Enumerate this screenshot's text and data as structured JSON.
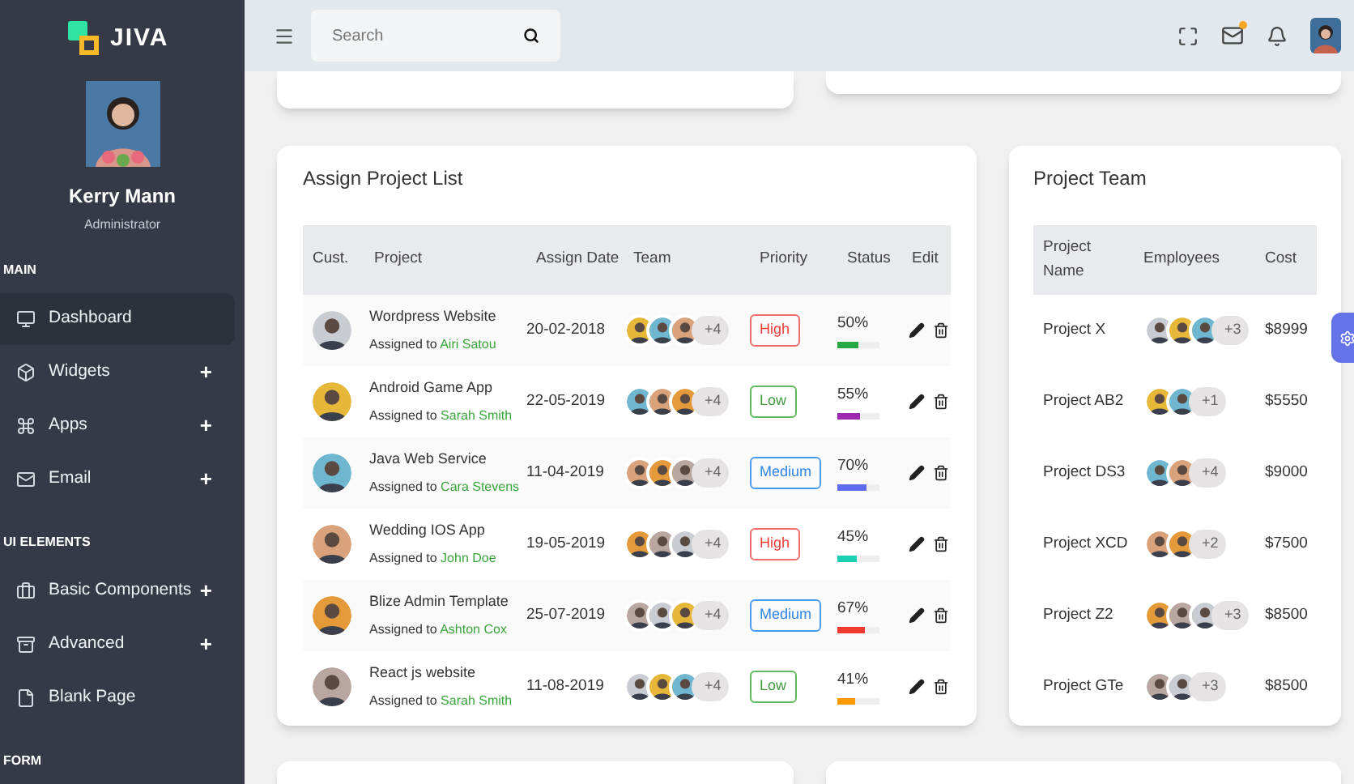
{
  "brand": {
    "name": "JIVA"
  },
  "profile": {
    "name": "Kerry Mann",
    "role": "Administrator"
  },
  "sidebar": {
    "sections": [
      {
        "title": "MAIN",
        "items": [
          {
            "label": "Dashboard",
            "selected": true
          },
          {
            "label": "Widgets",
            "selected": false,
            "toggle": "+"
          },
          {
            "label": "Apps",
            "selected": false,
            "toggle": "+"
          },
          {
            "label": "Email",
            "selected": false,
            "toggle": "+"
          }
        ]
      },
      {
        "title": "UI ELEMENTS",
        "items": [
          {
            "label": "Basic Components",
            "selected": false,
            "toggle": "+"
          },
          {
            "label": "Advanced",
            "selected": false,
            "toggle": "+"
          },
          {
            "label": "Blank Page",
            "selected": false
          }
        ]
      },
      {
        "title": "FORM"
      }
    ]
  },
  "header": {
    "search": {
      "placeholder": "Search"
    },
    "mail_unread": true
  },
  "assign_project_list": {
    "title": "Assign Project List",
    "columns": [
      "Cust.",
      "Project",
      "Assign Date",
      "Team",
      "Priority",
      "Status",
      "Edit"
    ],
    "rows": [
      {
        "project": "Wordpress Website",
        "assigned_prefix": "Assigned to",
        "assignee": "Airi Satou",
        "date": "20-02-2018",
        "team_more": "+4",
        "priority": {
          "label": "High",
          "kind": "high"
        },
        "status": "50%",
        "level": 0.5,
        "color": "#28a745"
      },
      {
        "project": "Android Game App",
        "assigned_prefix": "Assigned to",
        "assignee": "Sarah Smith",
        "date": "22-05-2019",
        "team_more": "+4",
        "priority": {
          "label": "Low",
          "kind": "low"
        },
        "status": "55%",
        "level": 0.55,
        "color": "#9c27b0"
      },
      {
        "project": "Java Web Service",
        "assigned_prefix": "Assigned to",
        "assignee": "Cara Stevens",
        "date": "11-04-2019",
        "team_more": "+4",
        "priority": {
          "label": "Medium",
          "kind": "medium"
        },
        "status": "70%",
        "level": 0.7,
        "color": "#5c6bf0"
      },
      {
        "project": "Wedding IOS App",
        "assigned_prefix": "Assigned to",
        "assignee": "John Doe",
        "date": "19-05-2019",
        "team_more": "+4",
        "priority": {
          "label": "High",
          "kind": "high"
        },
        "status": "45%",
        "level": 0.45,
        "color": "#1ccfb0"
      },
      {
        "project": "Blize Admin Template",
        "assigned_prefix": "Assigned to",
        "assignee": "Ashton Cox",
        "date": "25-07-2019",
        "team_more": "+4",
        "priority": {
          "label": "Medium",
          "kind": "medium"
        },
        "status": "67%",
        "level": 0.67,
        "color": "#f03a2e"
      },
      {
        "project": "React js website",
        "assigned_prefix": "Assigned to",
        "assignee": "Sarah Smith",
        "date": "11-08-2019",
        "team_more": "+4",
        "priority": {
          "label": "Low",
          "kind": "low"
        },
        "status": "41%",
        "level": 0.41,
        "color": "#ff9800"
      }
    ]
  },
  "project_team": {
    "title": "Project Team",
    "columns": [
      "Project Name",
      "Employees",
      "Cost"
    ],
    "rows": [
      {
        "name": "Project X",
        "more": "+3",
        "cost": "$8999"
      },
      {
        "name": "Project AB2",
        "more": "+1",
        "cost": "$5550"
      },
      {
        "name": "Project DS3",
        "more": "+4",
        "cost": "$9000"
      },
      {
        "name": "Project XCD",
        "more": "+2",
        "cost": "$7500"
      },
      {
        "name": "Project Z2",
        "more": "+3",
        "cost": "$8500"
      },
      {
        "name": "Project GTe",
        "more": "+3",
        "cost": "$8500"
      }
    ]
  }
}
